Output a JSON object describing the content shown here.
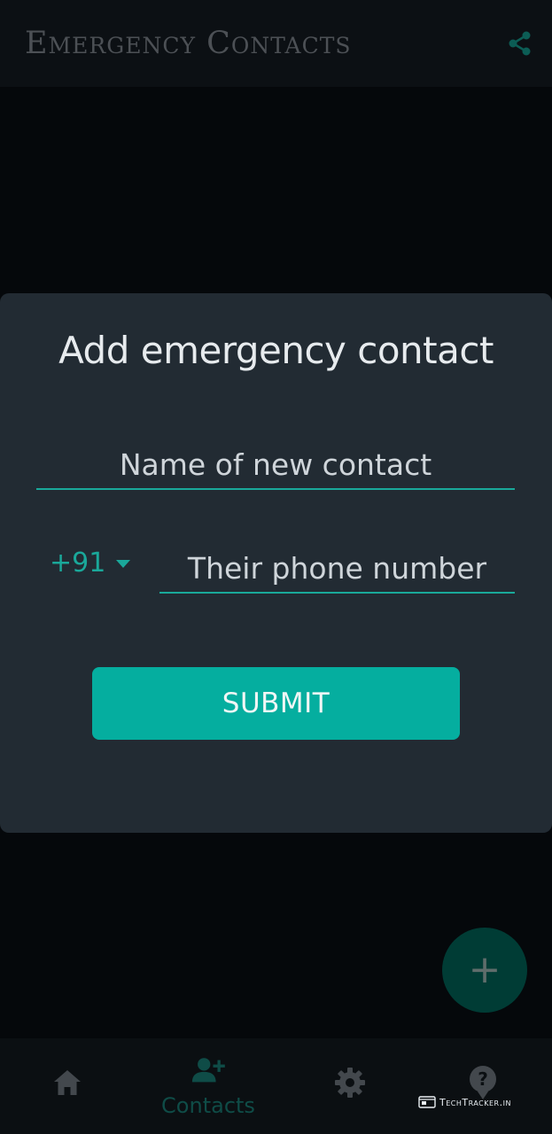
{
  "app_bar": {
    "title": "Emergency Contacts",
    "share_icon": "share-icon"
  },
  "modal": {
    "title": "Add emergency contact",
    "name_field": {
      "placeholder": "Name of new contact"
    },
    "country_code": {
      "value": "+91",
      "icon": "chevron-down-icon"
    },
    "phone_field": {
      "placeholder": "Their phone number"
    },
    "submit_label": "SUBMIT"
  },
  "fab": {
    "label": "+",
    "icon": "plus-icon"
  },
  "bottom_nav": {
    "items": [
      {
        "id": "home",
        "icon": "home-icon",
        "label": ""
      },
      {
        "id": "contacts",
        "icon": "add-person-icon",
        "label": "Contacts"
      },
      {
        "id": "settings",
        "icon": "gear-icon",
        "label": ""
      },
      {
        "id": "help",
        "icon": "help-icon",
        "label": ""
      }
    ]
  },
  "watermark": {
    "text": "TechTracker.in"
  },
  "colors": {
    "accent": "#05ae9f",
    "modal_bg": "#222b33",
    "page_bg": "#05080b",
    "dim_accent": "#0f4c47"
  }
}
